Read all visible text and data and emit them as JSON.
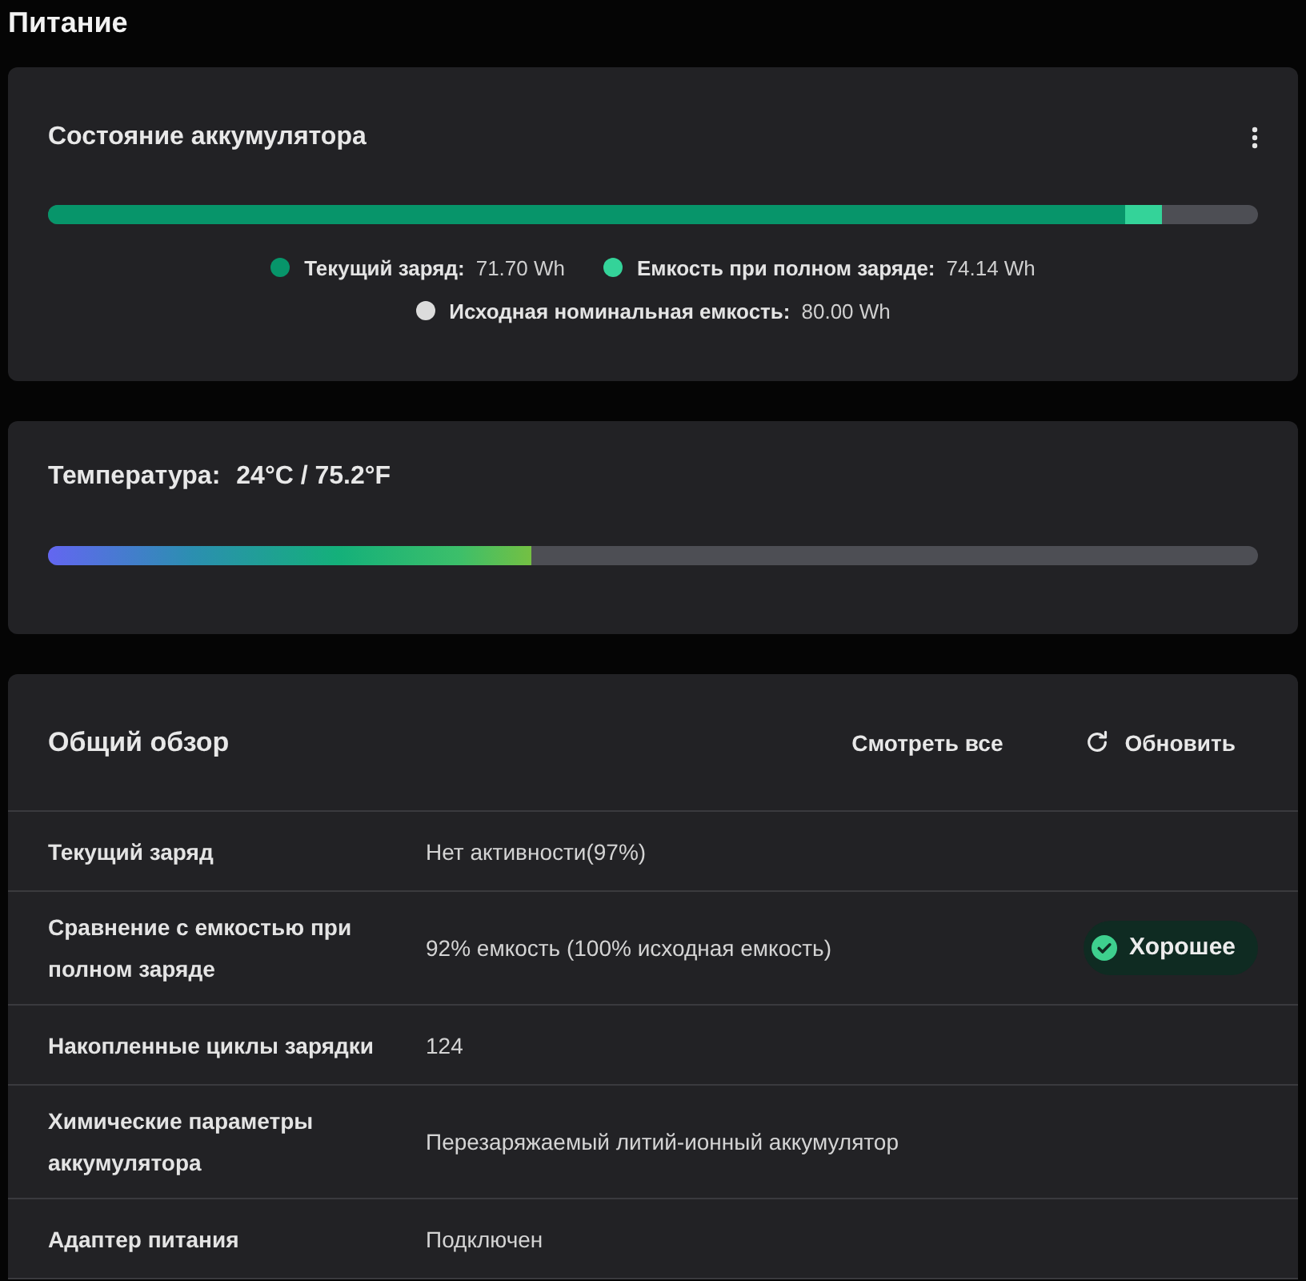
{
  "page_title": "Питание",
  "battery_status": {
    "title": "Состояние аккумулятора",
    "charge_bar": {
      "segments": [
        {
          "level": 0.89,
          "color": "#07956a"
        },
        {
          "level": 0.92,
          "color": "#34d399"
        }
      ]
    },
    "legend": [
      {
        "items": [
          {
            "label": "Текущий заряд:",
            "value": "71.70 Wh",
            "color": "#07956a"
          },
          {
            "label": "Емкость при полном заряде:",
            "value": "74.14 Wh",
            "color": "#34d399"
          }
        ]
      },
      {
        "items": [
          {
            "label": "Исходная номинальная емкость:",
            "value": "80.00 Wh",
            "color": "#dcdcdc"
          }
        ]
      }
    ]
  },
  "temperature": {
    "label": "Температура:",
    "value": "24°C / 75.2°F",
    "level": 0.4
  },
  "overview": {
    "title": "Общий обзор",
    "actions": [
      {
        "kind": "link",
        "label": "Смотреть все"
      },
      {
        "kind": "refresh",
        "label": "Обновить"
      }
    ],
    "rows": [
      {
        "label": "Текущий заряд",
        "value": "Нет активности(97%)"
      },
      {
        "label": "Сравнение с емкостью при полном заряде",
        "value": "92% емкость (100% исходная емкость)",
        "badge": {
          "label": "Хорошее"
        }
      },
      {
        "label": "Накопленные циклы зарядки",
        "value": "124"
      },
      {
        "label": "Химические параметры аккумулятора",
        "value": "Перезаряжаемый литий-ионный аккумулятор"
      },
      {
        "label": "Адаптер питания",
        "value": "Подключен"
      }
    ]
  }
}
